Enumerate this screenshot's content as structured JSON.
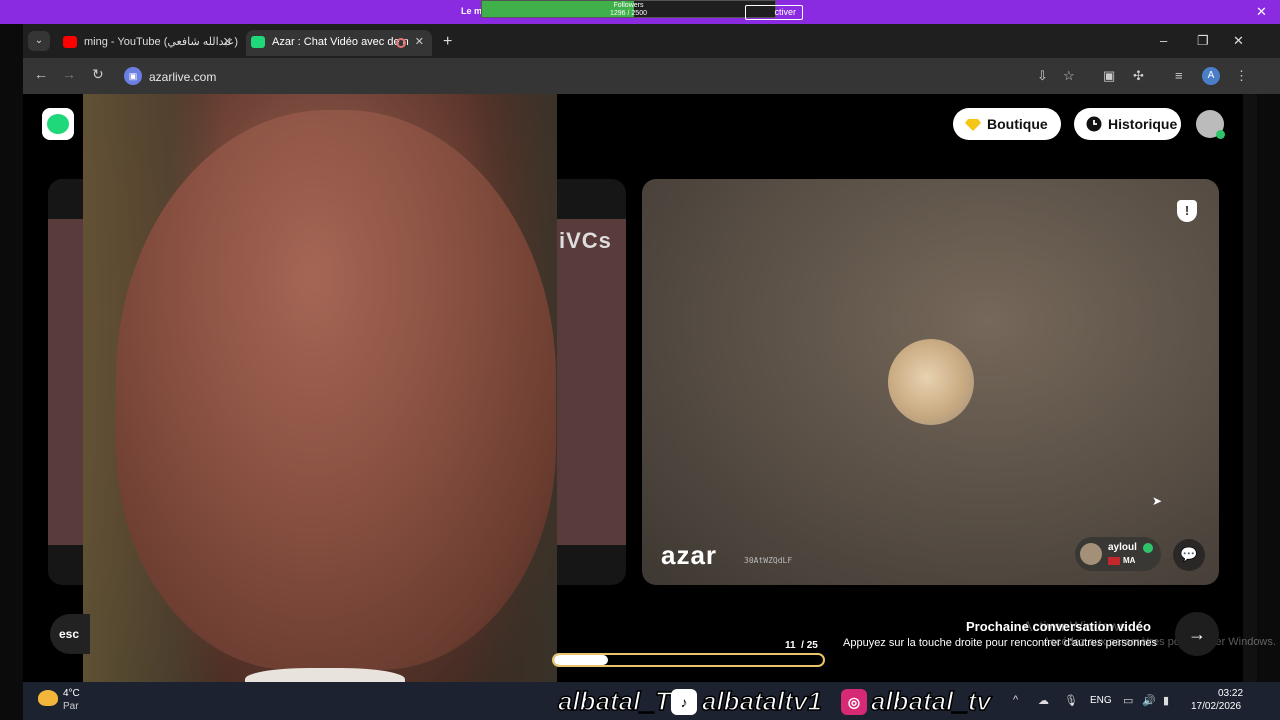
{
  "banner": {
    "text": "Le m",
    "followers_label": "Followers",
    "followers_count": "1296 / 2500",
    "followers_progress": 0.518,
    "activate_label": "ctiver",
    "close_icon": "close-icon",
    "color": "#8a2be2"
  },
  "browser": {
    "tabs": [
      {
        "label": "ming - YouTube (عبدالله شافعي)",
        "favicon": "youtube-icon",
        "favicon_color": "#ff0000",
        "active": false
      },
      {
        "label": "Azar : Chat Vidéo avec de n",
        "favicon": "azar-icon",
        "favicon_color": "#1fd87a",
        "active": true
      }
    ],
    "url": "azarlive.com"
  },
  "header": {
    "boutique_label": "Boutique",
    "historique_label": "Historique"
  },
  "left_panel": {
    "text": "iVCs"
  },
  "right_panel": {
    "wordmark": "azar",
    "session_code": "30AtWZQdLF",
    "user_name": "ayloul",
    "user_country": "MA"
  },
  "next": {
    "title": "Prochaine conversation vidéo",
    "subtitle": "Appuyez sur la touche droite pour rencontrer d'autres personnes",
    "counter_current": "11",
    "counter_total": "/ 25",
    "progress": 0.2
  },
  "esc_label": "esc",
  "watermark": {
    "line1": "Activer Windows",
    "line2": "Accédez aux paramètres pour activer Windows."
  },
  "taskbar": {
    "weather_temp": "4°C",
    "weather_desc": "Par",
    "social": {
      "youtube": "albatal_TV",
      "tiktok": "albataltv1",
      "instagram": "albatal_tv"
    },
    "lang": "ENG",
    "time": "03:22",
    "date": "17/02/2026"
  }
}
